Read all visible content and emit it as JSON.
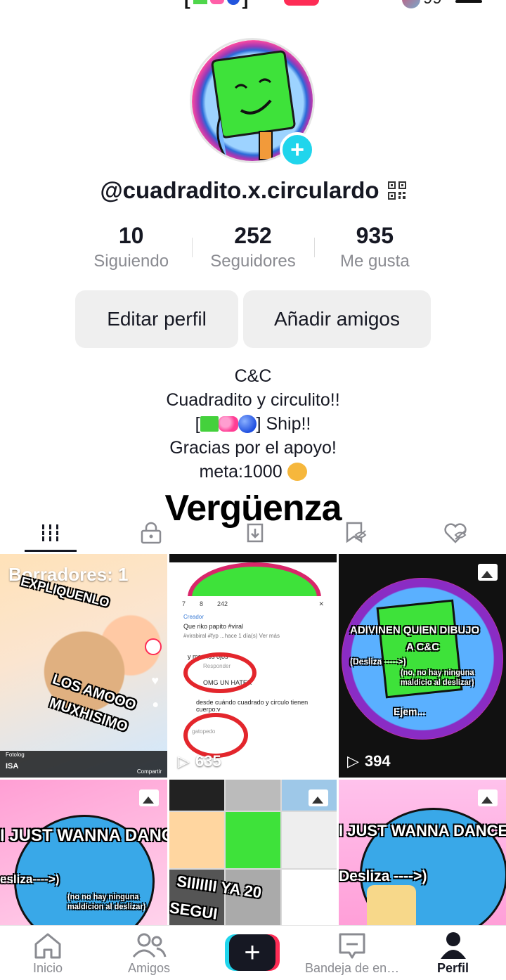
{
  "header": {
    "partial_title_suffix": "]",
    "inbox_count": "99"
  },
  "profile": {
    "username": "@cuadradito.x.circulardo",
    "stats": [
      {
        "value": "10",
        "label": "Siguiendo"
      },
      {
        "value": "252",
        "label": "Seguidores"
      },
      {
        "value": "935",
        "label": "Me gusta"
      }
    ],
    "edit_button": "Editar perfil",
    "add_friends_button": "Añadir amigos",
    "bio": {
      "line1": "C&C",
      "line2": "Cuadradito y circulito!!",
      "line3_prefix": "[",
      "line3_suffix": "] Ship!!",
      "line4": "Gracias por el apoyo!",
      "line5": "meta:1000"
    }
  },
  "overlay_text": "Vergüenza",
  "tabs": [
    {
      "name": "videos",
      "icon": "grid-icon",
      "active": true
    },
    {
      "name": "private",
      "icon": "lock-icon",
      "active": false
    },
    {
      "name": "reposts",
      "icon": "repost-icon",
      "active": false
    },
    {
      "name": "saved",
      "icon": "bookmark-icon",
      "active": false
    },
    {
      "name": "liked",
      "icon": "heart-icon",
      "active": false
    }
  ],
  "grid": {
    "drafts_label": "Borradores: 1",
    "cell1_texts": [
      "EXPLIQUENLO",
      "LOS AMOOO",
      "MUXHISIMO",
      "ISA",
      "Fotolog",
      "Compartir"
    ],
    "cell2_views": "635",
    "cell2_comments": {
      "count_comments": "7",
      "count_likes": "8",
      "count_views": "242",
      "creator": "Creador",
      "caption": "Que riko papito #viral",
      "caption2": "#virabiral #fyp ...hace 1 día(s)  Ver más",
      "c1": "y men los ojos",
      "reply": "Responder",
      "c2": "OMG UN HATER",
      "c3": "desde cuándo cuadrado y circulo tienen cuerpo:v",
      "user": "gatopedo"
    },
    "cell3_views": "394",
    "cell3_texts": [
      "ADIVINEN QUIEN DIBUJO",
      "A C&C",
      "(Desliza ----->)",
      "(no, no hay ninguna maldicio al deslizar)",
      "Ejem..."
    ],
    "cell4_texts": [
      "I JUST WANNA DANC",
      "esliza---->)",
      "(no no hay ninguna maldicion al deslizar)"
    ],
    "cell5_texts": [
      "SIIIIIII YA 20",
      "SEGUI"
    ],
    "cell6_texts": [
      "I JUST WANNA DANCE",
      "Desliza ---->)"
    ]
  },
  "nav": [
    {
      "label": "Inicio",
      "icon": "home-icon"
    },
    {
      "label": "Amigos",
      "icon": "friends-icon"
    },
    {
      "label": "",
      "icon": "plus-icon"
    },
    {
      "label": "Bandeja de en…",
      "icon": "inbox-icon"
    },
    {
      "label": "Perfil",
      "icon": "profile-icon"
    }
  ],
  "colors": {
    "accent_pink": "#fe2c55",
    "accent_cyan": "#20d5ec",
    "text_primary": "#161823",
    "text_secondary": "#8a8b91"
  }
}
